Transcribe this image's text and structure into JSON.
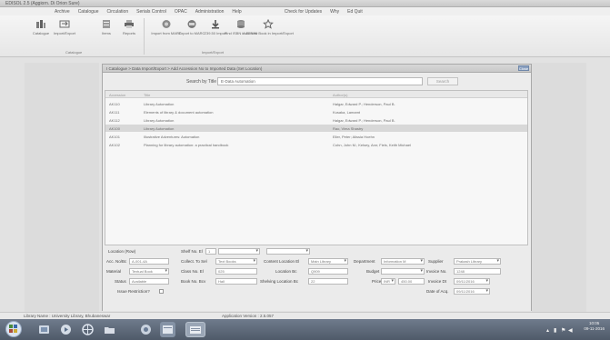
{
  "window": {
    "title": "EDISOL 2.5 (Aggiorn. Di Orion Sure)"
  },
  "menu": {
    "items": [
      "Archive",
      "Catalogue",
      "Circulation",
      "Serials Control",
      "OPAC",
      "Administration",
      "Help"
    ],
    "right_items": [
      "Check for Updates",
      "Why",
      "Ed Quit"
    ]
  },
  "ribbon": {
    "buttons": [
      {
        "label": "Catalogue",
        "icon": "book-stack-icon"
      },
      {
        "label": "Import/Export",
        "icon": "import-export-icon"
      },
      {
        "label": "Items",
        "icon": "items-icon"
      },
      {
        "label": "Reports",
        "icon": "printer-icon"
      },
      {
        "label": "Import from MARC",
        "icon": "marc-import-icon"
      },
      {
        "label": "Export to MARC",
        "icon": "marc-export-icon"
      },
      {
        "label": "Z39.50 Import",
        "icon": "download-arrow-icon"
      },
      {
        "label": "Find ISBN in Z39.50",
        "icon": "database-search-icon"
      },
      {
        "label": "Add New Book in Import/Export",
        "icon": "add-book-icon"
      }
    ],
    "groups": [
      {
        "label": "Catalogue"
      },
      {
        "label": "Import/Export"
      }
    ]
  },
  "child_window": {
    "breadcrumb": "I Catalogue > Data Import/Export > Add Accession No to Imported Data (Set Location)",
    "close_label": "Close",
    "search_label": "Search by Title",
    "search_value": "E-Data Automation",
    "search_button": "Search"
  },
  "grid": {
    "headers": [
      "Accession",
      "Title",
      "Author(s)"
    ],
    "rows": [
      {
        "acc": "AK110",
        "title": "Library Automation",
        "author": "Halgar, Edward P.; Henderson, Paul B.",
        "selected": false
      },
      {
        "acc": "AK111",
        "title": "Elements of library & document automation",
        "author": "Kusaka, Lamamt",
        "selected": false
      },
      {
        "acc": "AK112",
        "title": "Library Automation",
        "author": "Halgar, Edward P.; Henderson, Paul B.",
        "selected": false
      },
      {
        "acc": "AK100",
        "title": "Library Automation",
        "author": "Rao, Vima Shastry",
        "selected": true
      },
      {
        "acc": "AK101",
        "title": "Illustrative Adventures: Automation",
        "author": "Eller, Peter; Alissia Hoehn",
        "selected": false
      },
      {
        "acc": "AK102",
        "title": "Planning for library automation: a practical handbook",
        "author": "Cohn, John M.; Kelsey, Ann; Fiels, Keith Michael",
        "selected": false
      }
    ]
  },
  "form": {
    "location_label": "Location (Row)",
    "shelf_label": "Shelf No. El",
    "shelf_value": "1",
    "shelf_dd1": "",
    "shelf_dd2": "",
    "accno_label": "Acc. No/Bc",
    "accno_value": "A-001-4A",
    "collect_label": "Collect. To Sel",
    "collect_value": "Text Books",
    "content_loc_label": "Content Location El",
    "content_loc_value": "Main Library",
    "department_label": "Department",
    "department_value": "Information M",
    "supplier_label": "Supplier",
    "supplier_value": "Prakash Library",
    "material_label": "Material",
    "material_value": "Textual Book",
    "class_label": "Class No. El",
    "class_value": "025",
    "location_bc_label": "Location Bc",
    "location_bc_value": "Q909",
    "budget_label": "Budget",
    "budget_value": "",
    "invoice_label": "Invoice No.",
    "invoice_value": "1248",
    "status_label": "Status",
    "status_value": "Available",
    "bookno_label": "Book No. Bcv",
    "bookno_value": "Hall",
    "shelving_label": "Shelving Location Bc",
    "shelving_value": "22",
    "price_label": "Price",
    "price_currency": "INR",
    "price_value": "450.00",
    "invoice_dt_label": "Invoice Dt",
    "invoice_dt_value": "09/11/2016",
    "issue_label": "Issue Restriction?",
    "date_label": "Date of Acq.",
    "date_value": "09/11/2016"
  },
  "statusbar": {
    "user": "Library Name : University Library, Bhubaneswar",
    "version": "Application Version : 2.5.057"
  },
  "taskbar": {
    "apps": [
      {
        "icon": "explorer-icon"
      },
      {
        "icon": "media-player-icon"
      },
      {
        "icon": "browser-icon"
      },
      {
        "icon": "folder-icon"
      },
      {
        "icon": "app-window-icon"
      },
      {
        "icon": "library-app-icon"
      }
    ],
    "clock_time": "10:05",
    "clock_date": "09-11-2016"
  }
}
